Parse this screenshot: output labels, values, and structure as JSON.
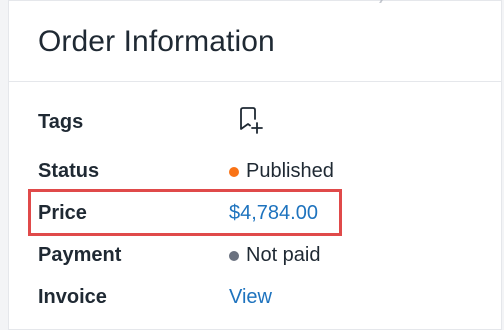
{
  "card": {
    "title": "Order Information"
  },
  "fields": {
    "tags": {
      "label": "Tags",
      "icon": "add-tag-icon"
    },
    "status": {
      "label": "Status",
      "value": "Published",
      "dot_color": "#f97316"
    },
    "price": {
      "label": "Price",
      "value": "$4,784.00"
    },
    "payment": {
      "label": "Payment",
      "value": "Not paid",
      "dot_color": "#6b7280"
    },
    "invoice": {
      "label": "Invoice",
      "link_text": "View"
    }
  },
  "colors": {
    "link": "#1e73be",
    "highlight": "#e04a4a"
  }
}
